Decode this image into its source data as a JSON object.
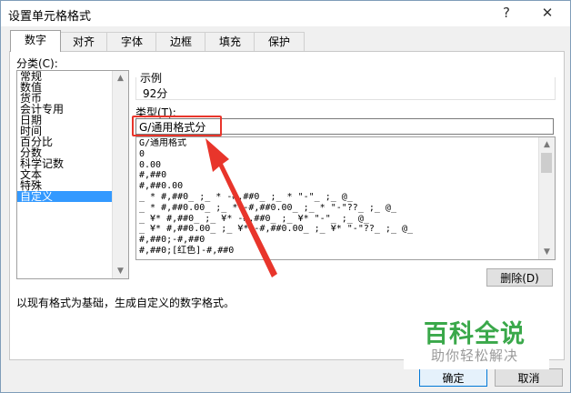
{
  "window": {
    "title": "设置单元格格式",
    "help_label": "?",
    "close_label": "✕"
  },
  "tabs": [
    {
      "label": "数字",
      "active": true
    },
    {
      "label": "对齐",
      "active": false
    },
    {
      "label": "字体",
      "active": false
    },
    {
      "label": "边框",
      "active": false
    },
    {
      "label": "填充",
      "active": false
    },
    {
      "label": "保护",
      "active": false
    }
  ],
  "category": {
    "label": "分类(C):",
    "items": [
      "常规",
      "数值",
      "货币",
      "会计专用",
      "日期",
      "时间",
      "百分比",
      "分数",
      "科学记数",
      "文本",
      "特殊",
      "自定义"
    ],
    "selected_index": 11
  },
  "sample": {
    "label": "示例",
    "value": "92分"
  },
  "type": {
    "label": "类型(T):",
    "value": "G/通用格式分"
  },
  "format_list": {
    "items": [
      "G/通用格式",
      "0",
      "0.00",
      "#,##0",
      "#,##0.00",
      "_ * #,##0_ ;_ * -#,##0_ ;_ * \"-\"_ ;_ @_",
      "_ * #,##0.00_ ;_ * -#,##0.00_ ;_ * \"-\"??_ ;_ @_",
      "_ ¥* #,##0_ ;_ ¥* -#,##0_ ;_ ¥* \"-\"_ ;_ @_",
      "_ ¥* #,##0.00_ ;_ ¥* -#,##0.00_ ;_ ¥* \"-\"??_ ;_ @_",
      "#,##0;-#,##0",
      "#,##0;[红色]-#,##0"
    ]
  },
  "buttons": {
    "delete_label": "删除(D)",
    "ok_label": "确定",
    "cancel_label": "取消"
  },
  "description": "以现有格式为基础，生成自定义的数字格式。",
  "watermark": {
    "main": "百科全说",
    "sub": "助你轻松解决"
  },
  "colors": {
    "selection": "#3399ff",
    "annotation": "#e8352b",
    "watermark_green": "#3aa84a"
  }
}
